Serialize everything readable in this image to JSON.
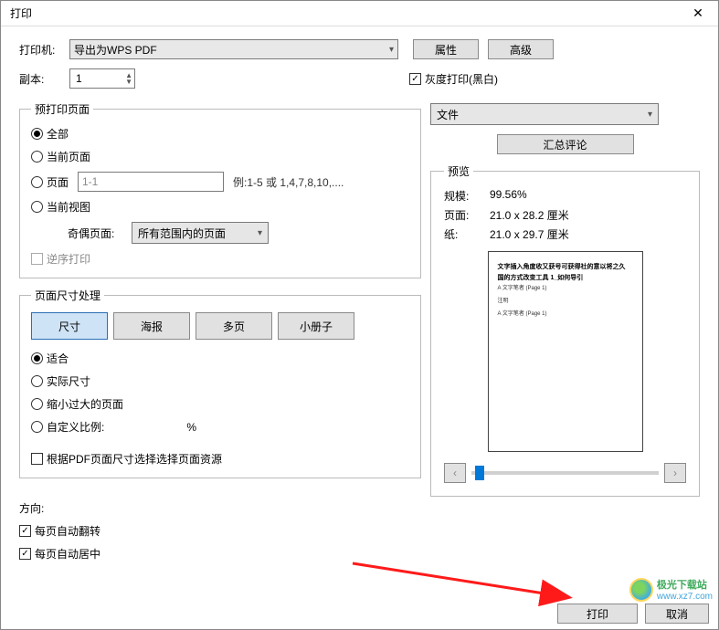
{
  "title": "打印",
  "printer": {
    "label": "打印机:",
    "value": "导出为WPS PDF",
    "properties_btn": "属性",
    "advanced_btn": "高级"
  },
  "copies": {
    "label": "副本:",
    "value": "1"
  },
  "grayscale": {
    "checked": true,
    "label": "灰度打印(黑白)"
  },
  "page_range": {
    "legend": "预打印页面",
    "all": "全部",
    "current_page": "当前页面",
    "pages": "页面",
    "pages_value": "1-1",
    "pages_example": "例:1-5 或 1,4,7,8,10,....",
    "current_view": "当前视图",
    "odd_even_label": "奇偶页面:",
    "odd_even_value": "所有范围内的页面",
    "reverse_label": "逆序打印"
  },
  "size_handling": {
    "legend": "页面尺寸处理",
    "tabs": {
      "size": "尺寸",
      "poster": "海报",
      "multi": "多页",
      "booklet": "小册子"
    },
    "fit": "适合",
    "actual": "实际尺寸",
    "shrink": "缩小过大的页面",
    "custom": "自定义比例:",
    "percent": "%",
    "choose_by_pdf": "根据PDF页面尺寸选择选择页面资源"
  },
  "orientation": {
    "label": "方向:",
    "auto_flip": "每页自动翻转",
    "auto_center": "每页自动居中"
  },
  "file_dropdown": "文件",
  "summary_btn": "汇总评论",
  "preview": {
    "legend": "预览",
    "scale_label": "规模:",
    "scale_value": "99.56%",
    "page_label": "页面:",
    "page_value": "21.0 x 28.2 厘米",
    "paper_label": "纸:",
    "paper_value": "21.0 x 29.7 厘米",
    "doc_title": "文字插入角度收又获号可获得社的意以将之久",
    "doc_sub": "国的方式改变工具 1_如何导引",
    "doc_line1": "A 文字笔者 (Page 1)",
    "doc_line2": "注明",
    "doc_line3": "A 文字笔者 (Page 1)"
  },
  "footer": {
    "print_btn": "打印",
    "cancel_btn": "取消"
  },
  "watermark": {
    "name": "极光下载站",
    "url": "www.xz7.com"
  }
}
